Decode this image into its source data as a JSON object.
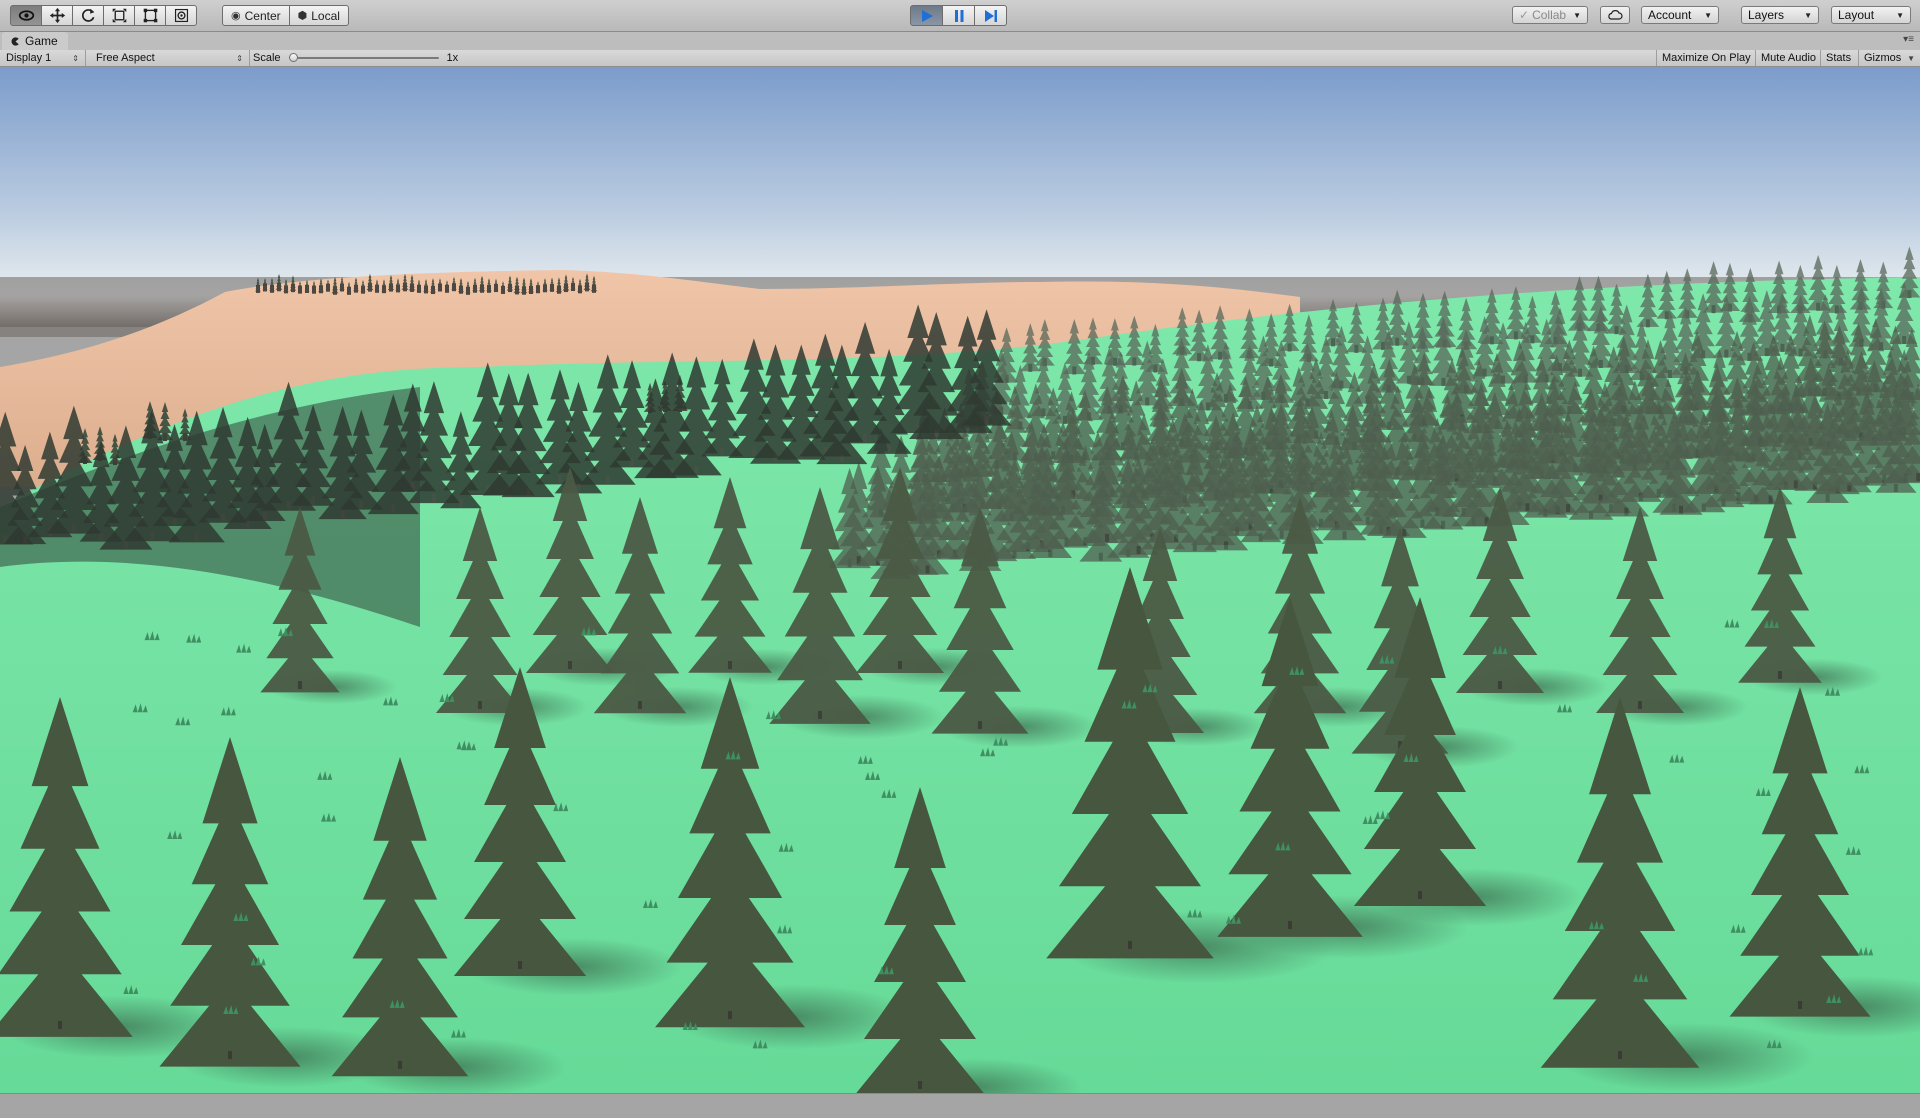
{
  "toolbar": {
    "tools": [
      {
        "name": "view-tool-icon",
        "active": true
      },
      {
        "name": "move-tool-icon",
        "active": false
      },
      {
        "name": "rotate-tool-icon",
        "active": false
      },
      {
        "name": "scale-tool-icon",
        "active": false
      },
      {
        "name": "rect-tool-icon",
        "active": false
      },
      {
        "name": "transform-tool-icon",
        "active": false
      }
    ],
    "pivot_label": "Center",
    "pivot_icon": "pivot-icon",
    "rotation_label": "Local",
    "rotation_icon": "local-icon",
    "play_state": {
      "playing": true,
      "paused": false
    },
    "collab_label": "Collab",
    "account_label": "Account",
    "layers_label": "Layers",
    "layout_label": "Layout",
    "cloud_icon": "cloud-icon",
    "caret": "▼",
    "check": "✓"
  },
  "tab": {
    "title": "Game",
    "icon": "game-tab-icon",
    "menu_glyph": "▾≡"
  },
  "gameview": {
    "display": "Display 1",
    "aspect": "Free Aspect",
    "scale_label": "Scale",
    "scale_value": "1x",
    "scale_fraction": 0.0,
    "maximize_label": "Maximize On Play",
    "mute_label": "Mute Audio",
    "stats_label": "Stats",
    "gizmos_label": "Gizmos",
    "caret": "▼",
    "updown": "⇕"
  },
  "colors": {
    "sky_top": "#7c9ccb",
    "sky_horizon": "#e9eef0",
    "sand": "#e8b99a",
    "grass": "#6ee09e",
    "tree": "#4a5a44",
    "play_active": "#1f6fd6"
  }
}
